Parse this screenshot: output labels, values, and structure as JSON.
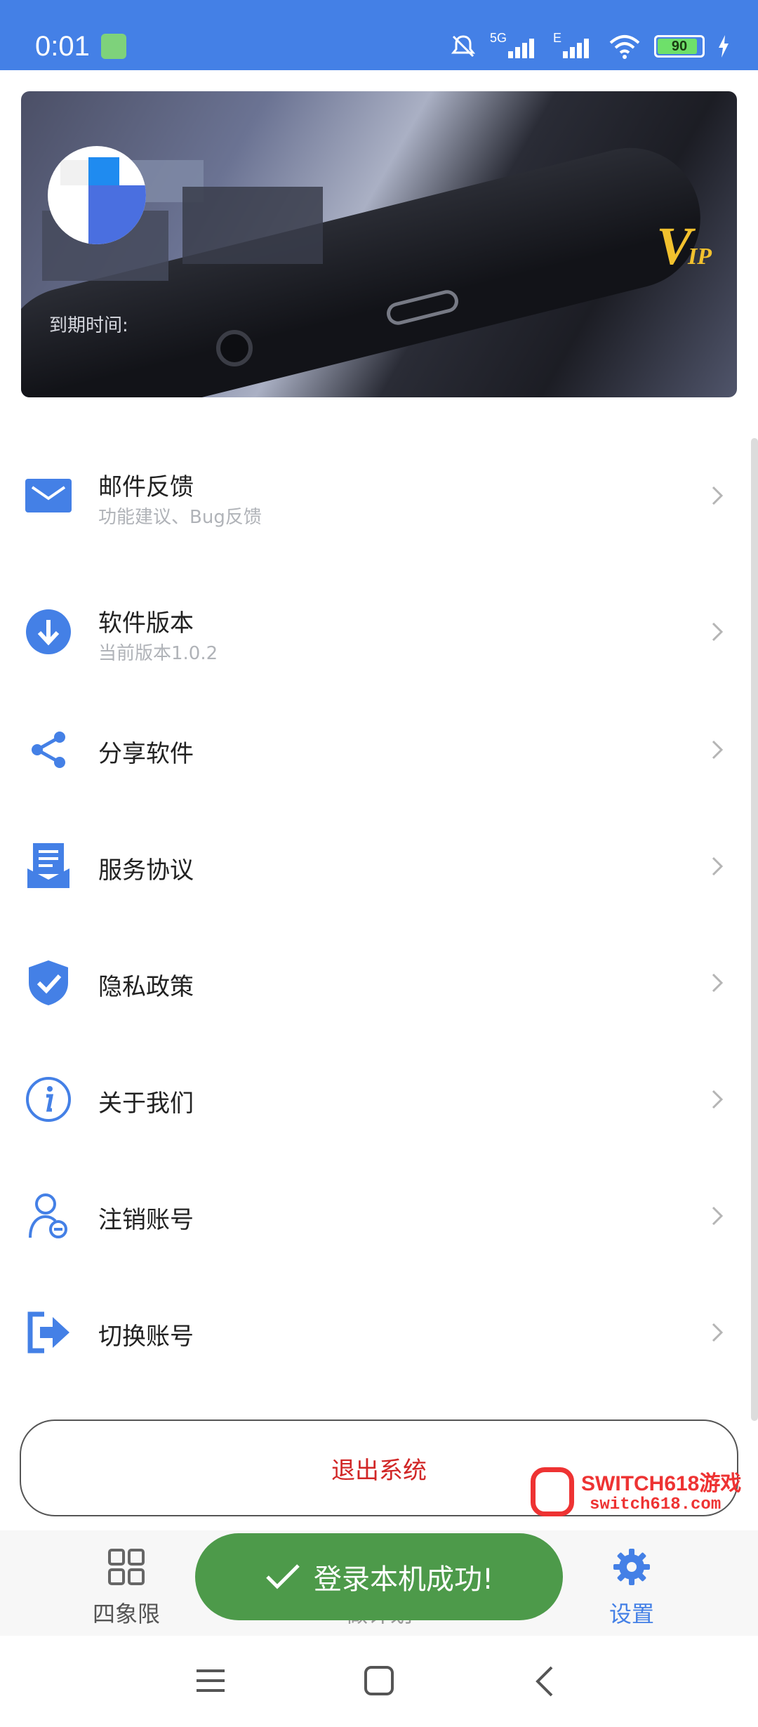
{
  "status_bar": {
    "time": "0:01",
    "network_1": "5G",
    "network_2": "E",
    "battery": "90"
  },
  "profile": {
    "expiry_label": "到期时间:",
    "badge_v": "V",
    "badge_ip": "IP"
  },
  "menu": [
    {
      "title": "邮件反馈",
      "subtitle": "功能建议、Bug反馈",
      "icon": "mail-icon"
    },
    {
      "title": "软件版本",
      "subtitle": "当前版本1.0.2",
      "icon": "download-icon"
    },
    {
      "title": "分享软件",
      "icon": "share-icon"
    },
    {
      "title": "服务协议",
      "icon": "document-icon"
    },
    {
      "title": "隐私政策",
      "icon": "shield-check-icon"
    },
    {
      "title": "关于我们",
      "icon": "info-icon"
    },
    {
      "title": "注销账号",
      "icon": "user-remove-icon"
    },
    {
      "title": "切换账号",
      "icon": "logout-arrow-icon"
    }
  ],
  "logout_label": "退出系统",
  "watermark": {
    "line1": "SWITCH618游戏",
    "line2": "switch618.com"
  },
  "tabs": [
    {
      "label": "四象限",
      "icon": "grid-icon"
    },
    {
      "label": "做计划",
      "icon": "plan-icon"
    },
    {
      "label": "设置",
      "icon": "gear-icon",
      "active": true
    }
  ],
  "toast": "登录本机成功!",
  "colors": {
    "primary": "#4480e6",
    "danger": "#d12626",
    "toast": "#4d9a4a",
    "vip": "#f2c12e"
  }
}
